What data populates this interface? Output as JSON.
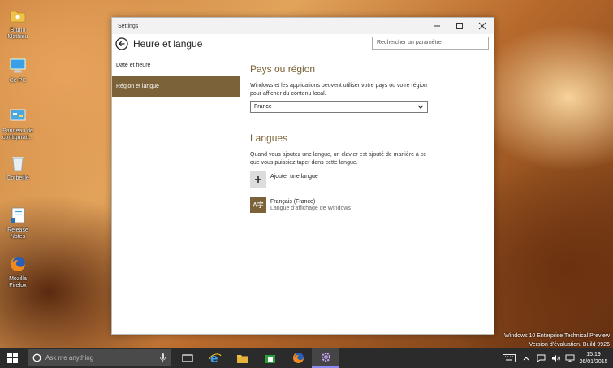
{
  "desktop": {
    "icons": [
      {
        "label": "Bruno Mathieu",
        "icon": "user-folder-icon"
      },
      {
        "label": "Ce PC",
        "icon": "computer-icon"
      },
      {
        "label": "Panneau de configurati...",
        "icon": "control-panel-icon"
      },
      {
        "label": "Corbeille",
        "icon": "recycle-bin-icon"
      },
      {
        "label": "Release Notes",
        "icon": "release-notes-icon"
      },
      {
        "label": "Mozilla Firefox",
        "icon": "firefox-icon"
      }
    ]
  },
  "window": {
    "title": "Settings",
    "header_title": "Heure et langue",
    "search_placeholder": "Rechercher un paramètre",
    "nav": [
      {
        "label": "Date et heure",
        "active": false
      },
      {
        "label": "Région et langue",
        "active": true
      }
    ],
    "region": {
      "title": "Pays ou région",
      "description": "Windows et les applications peuvent utiliser votre pays ou votre région pour afficher du contenu local.",
      "selected": "France"
    },
    "languages": {
      "title": "Langues",
      "description": "Quand vous ajoutez une langue, un clavier est ajouté de manière à ce que vous puissiez taper dans cette langue.",
      "add_label": "Ajouter une langue",
      "items": [
        {
          "name": "Français (France)",
          "sub": "Langue d'affichage de Windows"
        }
      ]
    }
  },
  "watermark": {
    "line1": "Windows 10 Enterprise Technical Preview",
    "line2": "Version d'évaluation. Build 9926"
  },
  "taskbar": {
    "search_placeholder": "Ask me anything",
    "time": "15:19",
    "date": "26/01/2015"
  },
  "colors": {
    "accent": "#7b6238",
    "taskbar": "#2b2b2b"
  }
}
